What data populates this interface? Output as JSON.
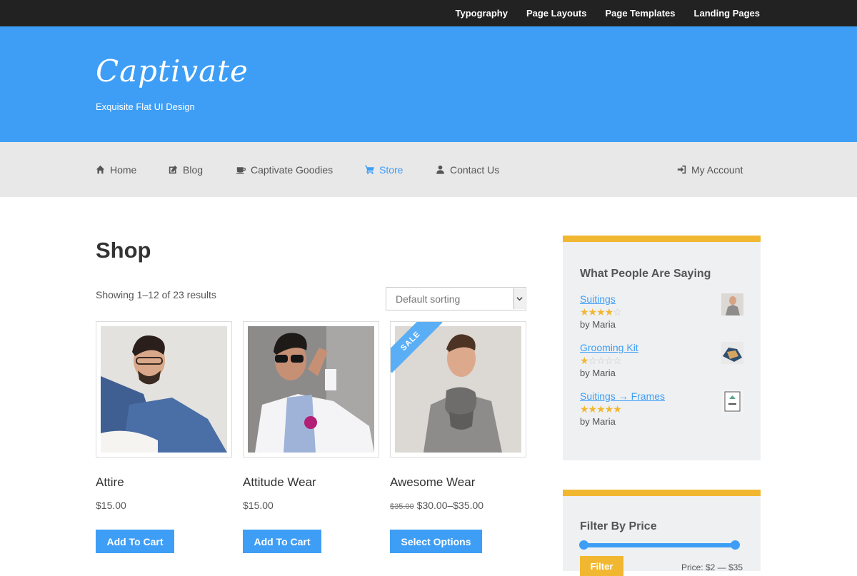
{
  "topbar": {
    "links": [
      "Typography",
      "Page Layouts",
      "Page Templates",
      "Landing Pages"
    ]
  },
  "header": {
    "logo": "Captivate",
    "tagline": "Exquisite Flat UI Design"
  },
  "nav": {
    "items": [
      {
        "label": "Home",
        "icon": "home-icon"
      },
      {
        "label": "Blog",
        "icon": "edit-icon"
      },
      {
        "label": "Captivate Goodies",
        "icon": "coffee-icon"
      },
      {
        "label": "Store",
        "icon": "cart-icon",
        "active": true
      },
      {
        "label": "Contact Us",
        "icon": "user-icon"
      },
      {
        "label": "My Account",
        "icon": "sign-in-icon"
      }
    ]
  },
  "shop": {
    "title": "Shop",
    "result_count": "Showing 1–12 of 23 results",
    "sort_value": "Default sorting"
  },
  "products": [
    {
      "name": "Attire",
      "price": "$15.00",
      "button": "Add To Cart"
    },
    {
      "name": "Attitude Wear",
      "price": "$15.00",
      "button": "Add To Cart"
    },
    {
      "name": "Awesome Wear",
      "old_price": "$35.00",
      "price": "$30.00–$35.00",
      "button": "Select Options",
      "badge": "SALE"
    }
  ],
  "reviews_widget": {
    "title": "What People Are Saying",
    "reviews": [
      {
        "title": "Suitings",
        "rating": 4,
        "by": "by Maria"
      },
      {
        "title": "Grooming Kit",
        "rating": 1,
        "by": "by Maria"
      },
      {
        "title": "Suitings → Frames",
        "rating": 5,
        "by": "by Maria"
      }
    ]
  },
  "price_widget": {
    "title": "Filter By Price",
    "button": "Filter",
    "price_label": "Price: $2 — $35"
  },
  "colors": {
    "brand_blue": "#3e9ef6",
    "accent_yellow": "#f1b731",
    "topbar_bg": "#222222",
    "nav_bg": "#e8e8e8"
  }
}
